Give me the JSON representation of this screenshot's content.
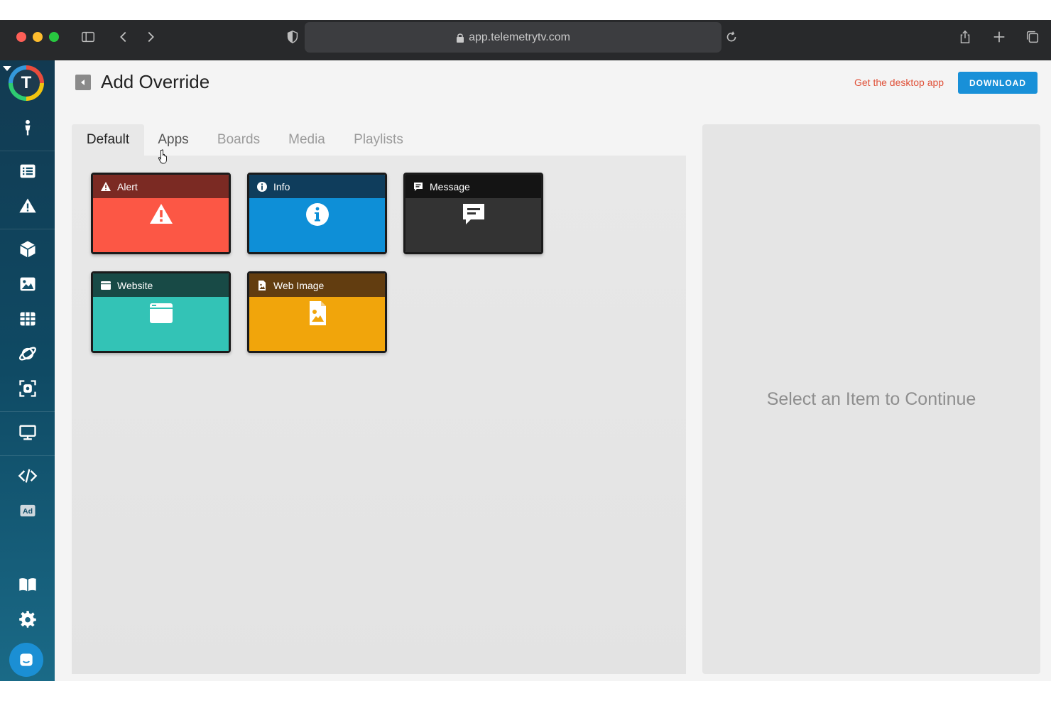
{
  "browser": {
    "url": "app.telemetrytv.com"
  },
  "sidebar": {
    "logo_letter": "T",
    "items": [
      {
        "icon": "person-icon"
      },
      {
        "icon": "list-icon"
      },
      {
        "icon": "warning-icon"
      },
      {
        "icon": "cube-icon"
      },
      {
        "icon": "image-icon"
      },
      {
        "icon": "grid-icon"
      },
      {
        "icon": "planet-icon"
      },
      {
        "icon": "screenshot-icon"
      },
      {
        "icon": "monitor-icon"
      },
      {
        "icon": "code-icon"
      },
      {
        "icon": "ad-icon"
      },
      {
        "icon": "book-icon"
      },
      {
        "icon": "gear-icon"
      },
      {
        "icon": "chat-icon"
      }
    ]
  },
  "header": {
    "title": "Add Override",
    "desktop_link": "Get the desktop app",
    "download_label": "DOWNLOAD"
  },
  "tabs": [
    {
      "label": "Default",
      "active": true
    },
    {
      "label": "Apps",
      "active": false
    },
    {
      "label": "Boards",
      "active": false
    },
    {
      "label": "Media",
      "active": false
    },
    {
      "label": "Playlists",
      "active": false
    }
  ],
  "cards": [
    {
      "label": "Alert",
      "icon": "warning-icon",
      "head_color": "#7b2a23",
      "body_color": "#fc5745"
    },
    {
      "label": "Info",
      "icon": "info-icon",
      "head_color": "#0f3d5c",
      "body_color": "#0e8fd7"
    },
    {
      "label": "Message",
      "icon": "message-icon",
      "head_color": "#141414",
      "body_color": "#333333"
    },
    {
      "label": "Website",
      "icon": "browser-window-icon",
      "head_color": "#184a46",
      "body_color": "#33c3b6"
    },
    {
      "label": "Web Image",
      "icon": "image-file-icon",
      "head_color": "#623d10",
      "body_color": "#f1a50b"
    }
  ],
  "right_panel": {
    "message": "Select an Item to Continue"
  },
  "colors": {
    "accent": "#1890d8",
    "link": "#e0523a",
    "sidebar": "#0f4a64"
  }
}
